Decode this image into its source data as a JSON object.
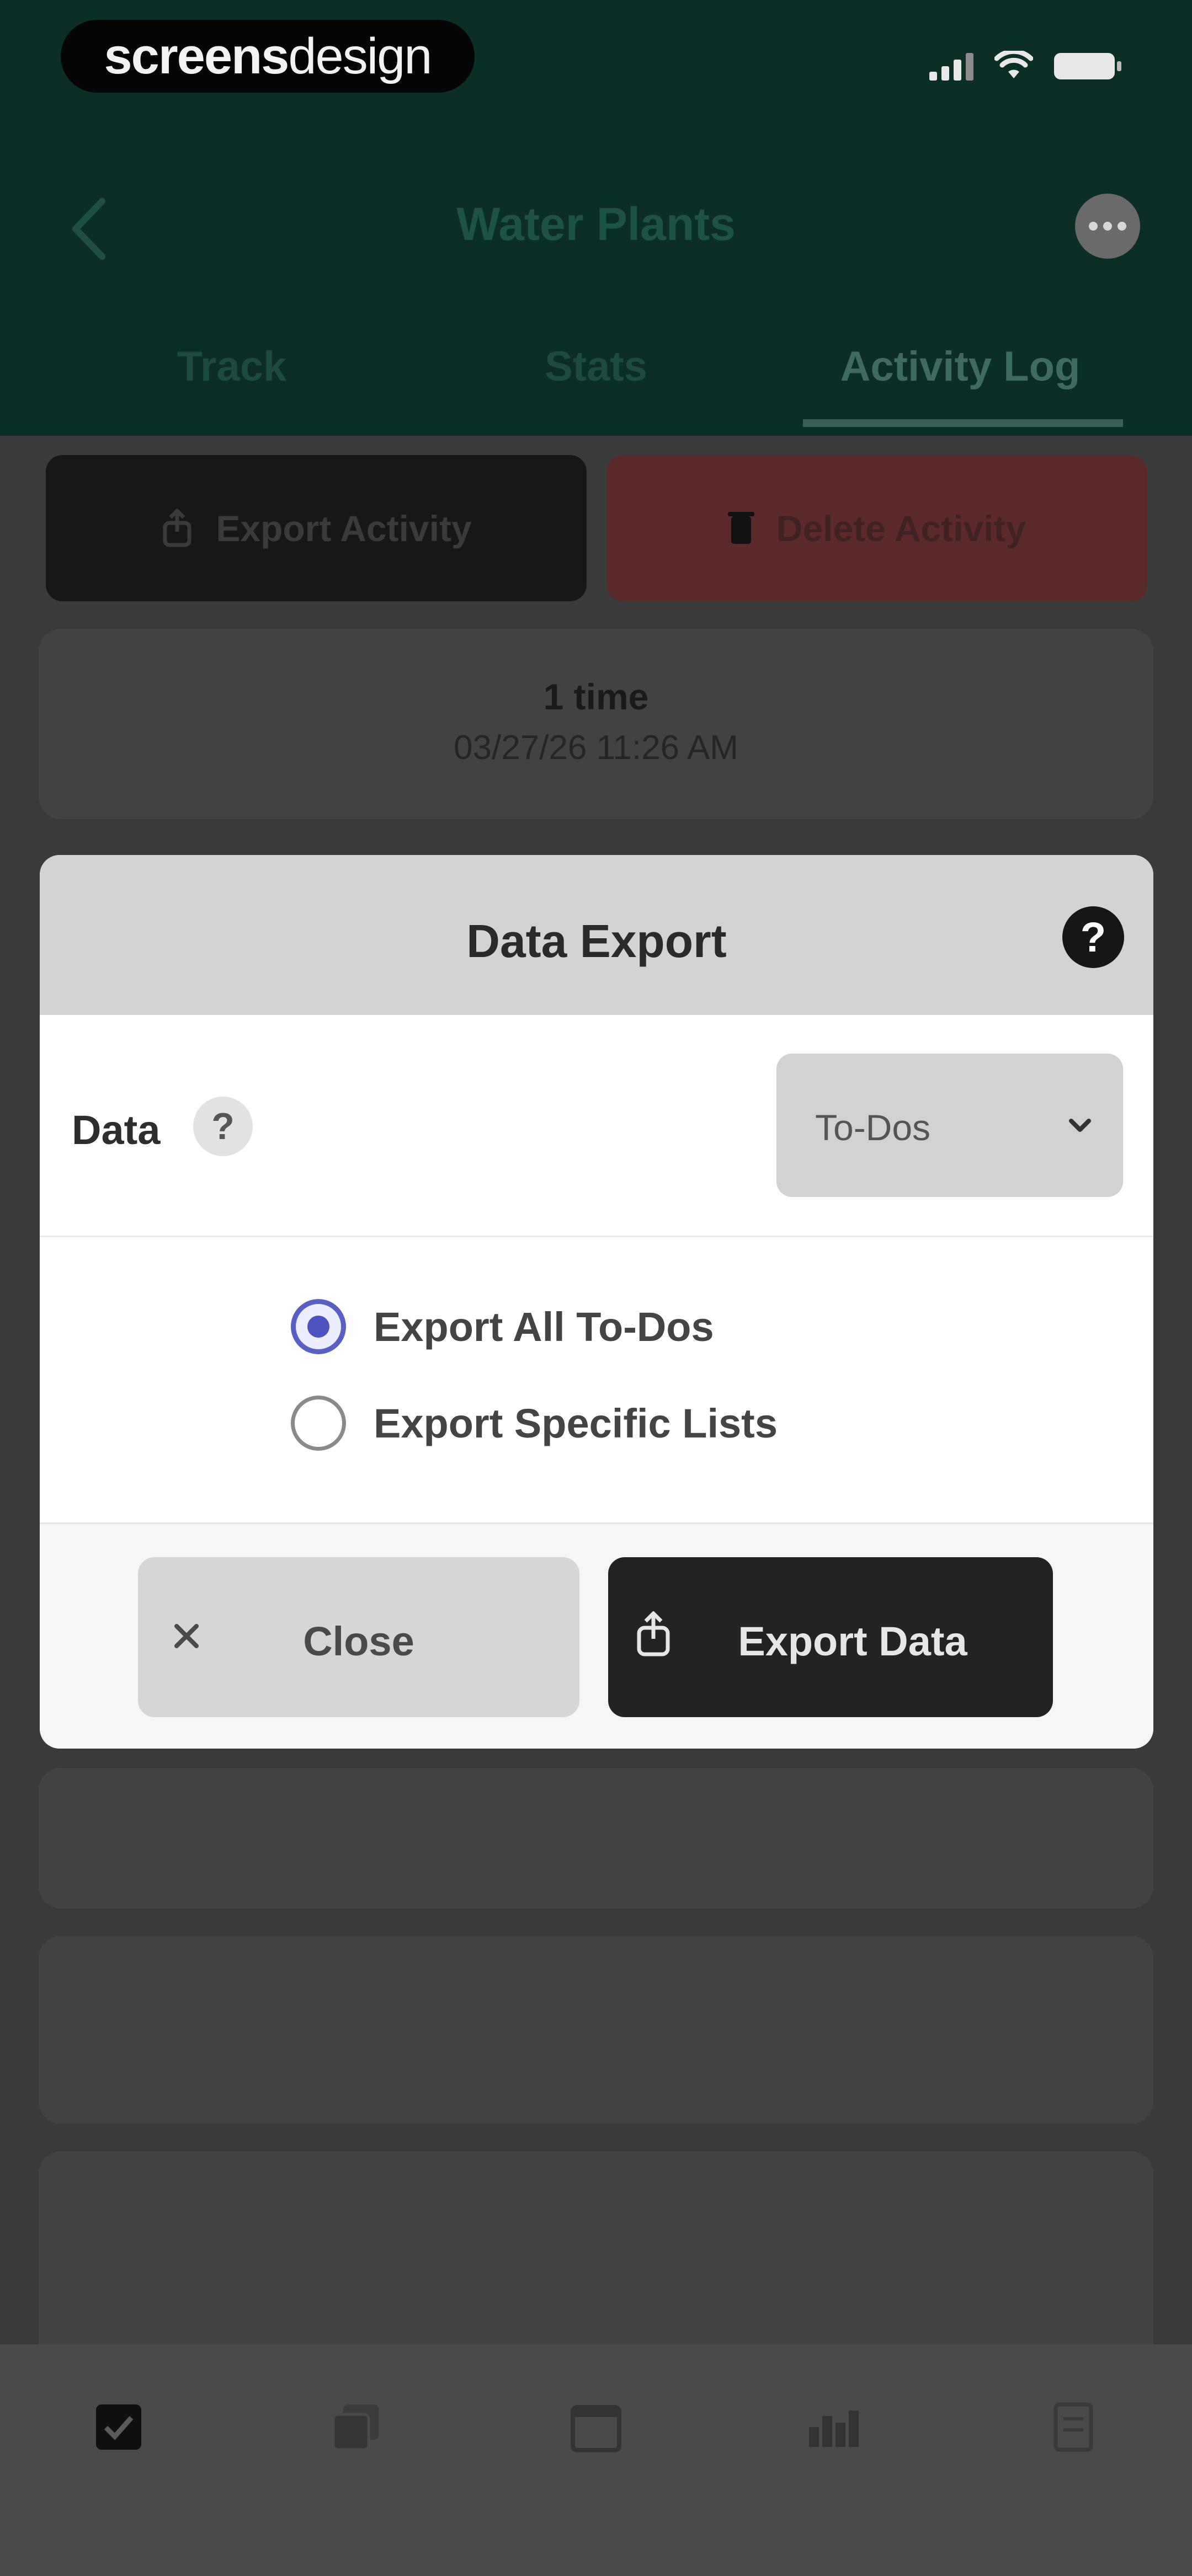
{
  "status_bar": {
    "brand_bold": "screens",
    "brand_light": "design"
  },
  "header": {
    "title": "Water Plants",
    "tabs": [
      {
        "label": "Track"
      },
      {
        "label": "Stats"
      },
      {
        "label": "Activity Log"
      }
    ],
    "active_tab": "Activity Log"
  },
  "actions": {
    "export_label": "Export Activity",
    "delete_label": "Delete Activity"
  },
  "log_entries": [
    {
      "count": "1 time",
      "timestamp": "03/27/26 11:26 AM"
    }
  ],
  "modal": {
    "title": "Data Export",
    "data_label": "Data",
    "data_select_value": "To-Dos",
    "radio_options": [
      {
        "label": "Export All To-Dos",
        "selected": true
      },
      {
        "label": "Export Specific Lists",
        "selected": false
      }
    ],
    "close_label": "Close",
    "export_label": "Export Data",
    "help_glyph": "?"
  },
  "colors": {
    "header_bg": "#0b2e26",
    "radio_accent": "#4c52c0",
    "delete_bg": "#5a2a2a"
  },
  "bottom_nav": {
    "icons": [
      "checkbox-icon",
      "lists-icon",
      "calendar-icon",
      "stats-icon",
      "settings-icon"
    ],
    "active": "checkbox-icon"
  }
}
